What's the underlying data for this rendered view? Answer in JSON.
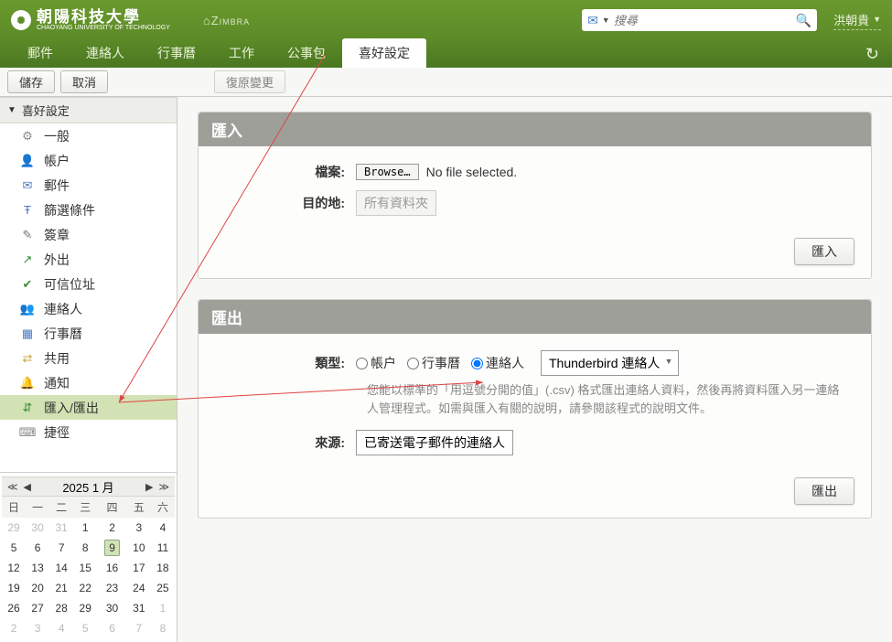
{
  "header": {
    "university_ch": "朝陽科技大學",
    "university_en": "CHAOYANG UNIVERSITY OF TECHNOLOGY",
    "product": "⌂Zimbra",
    "search_placeholder": "搜尋",
    "username": "洪朝貴"
  },
  "tabs": [
    "郵件",
    "連絡人",
    "行事曆",
    "工作",
    "公事包",
    "喜好設定"
  ],
  "active_tab": 5,
  "toolbar": {
    "save": "儲存",
    "cancel": "取消",
    "revert": "復原變更"
  },
  "sidebar": {
    "title": "喜好設定",
    "items": [
      {
        "icon": "⚙",
        "label": "一般",
        "color": "#888"
      },
      {
        "icon": "👤",
        "label": "帳户",
        "color": "#4a7bc4"
      },
      {
        "icon": "✉",
        "label": "郵件",
        "color": "#4a7bc4"
      },
      {
        "icon": "Ŧ",
        "label": "篩選條件",
        "color": "#4a7bc4"
      },
      {
        "icon": "✎",
        "label": "簽章",
        "color": "#777"
      },
      {
        "icon": "↗",
        "label": "外出",
        "color": "#3a8e3a"
      },
      {
        "icon": "✔",
        "label": "可信位址",
        "color": "#3a8e3a"
      },
      {
        "icon": "👥",
        "label": "連絡人",
        "color": "#c97"
      },
      {
        "icon": "▦",
        "label": "行事曆",
        "color": "#4a7bc4"
      },
      {
        "icon": "⇄",
        "label": "共用",
        "color": "#c9a642"
      },
      {
        "icon": "🔔",
        "label": "通知",
        "color": "#c9a642"
      },
      {
        "icon": "⇵",
        "label": "匯入/匯出",
        "color": "#3a8e3a"
      },
      {
        "icon": "⌨",
        "label": "捷徑",
        "color": "#888"
      }
    ],
    "selected": 11
  },
  "import": {
    "title": "匯入",
    "file_label": "檔案:",
    "browse": "Browse…",
    "nofile": "No file selected.",
    "dest_label": "目的地:",
    "dest_value": "所有資料夾",
    "button": "匯入"
  },
  "export": {
    "title": "匯出",
    "type_label": "類型:",
    "radio_account": "帳户",
    "radio_calendar": "行事曆",
    "radio_contacts": "連絡人",
    "format_select": "Thunderbird 連絡人",
    "hint": "您能以標準的「用逗號分開的值」(.csv) 格式匯出連絡人資料，然後再將資料匯入另一連絡人管理程式。如需與匯入有關的說明，請參閱該程式的說明文件。",
    "source_label": "來源:",
    "source_value": "已寄送電子郵件的連絡人",
    "button": "匯出"
  },
  "calendar": {
    "title": "2025 1 月",
    "dow": [
      "日",
      "一",
      "二",
      "三",
      "四",
      "五",
      "六"
    ],
    "weeks": [
      [
        {
          "d": 29,
          "o": 1
        },
        {
          "d": 30,
          "o": 1
        },
        {
          "d": 31,
          "o": 1
        },
        {
          "d": 1
        },
        {
          "d": 2
        },
        {
          "d": 3
        },
        {
          "d": 4
        }
      ],
      [
        {
          "d": 5
        },
        {
          "d": 6
        },
        {
          "d": 7
        },
        {
          "d": 8
        },
        {
          "d": 9,
          "t": 1
        },
        {
          "d": 10
        },
        {
          "d": 11
        }
      ],
      [
        {
          "d": 12
        },
        {
          "d": 13
        },
        {
          "d": 14
        },
        {
          "d": 15
        },
        {
          "d": 16
        },
        {
          "d": 17
        },
        {
          "d": 18
        }
      ],
      [
        {
          "d": 19
        },
        {
          "d": 20
        },
        {
          "d": 21
        },
        {
          "d": 22
        },
        {
          "d": 23
        },
        {
          "d": 24
        },
        {
          "d": 25
        }
      ],
      [
        {
          "d": 26
        },
        {
          "d": 27
        },
        {
          "d": 28
        },
        {
          "d": 29
        },
        {
          "d": 30
        },
        {
          "d": 31
        },
        {
          "d": 1,
          "o": 1
        }
      ],
      [
        {
          "d": 2,
          "o": 1
        },
        {
          "d": 3,
          "o": 1
        },
        {
          "d": 4,
          "o": 1
        },
        {
          "d": 5,
          "o": 1
        },
        {
          "d": 6,
          "o": 1
        },
        {
          "d": 7,
          "o": 1
        },
        {
          "d": 8,
          "o": 1
        }
      ]
    ]
  }
}
